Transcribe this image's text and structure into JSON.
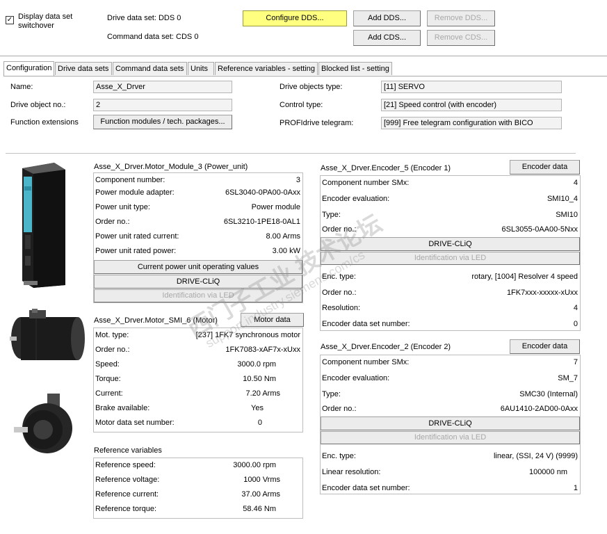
{
  "top": {
    "switchover_checked": true,
    "switchover_label_1": "Display data set",
    "switchover_label_2": "switchover",
    "dds_label": "Drive data set: DDS 0",
    "cds_label": "Command data set: CDS 0",
    "configure_dds": "Configure DDS...",
    "add_dds": "Add DDS...",
    "remove_dds": "Remove DDS...",
    "add_cds": "Add CDS...",
    "remove_cds": "Remove CDS..."
  },
  "tabs": [
    "Configuration",
    "Drive data sets",
    "Command data sets",
    "Units",
    "Reference variables - setting",
    "Blocked list - setting"
  ],
  "config": {
    "name_label": "Name:",
    "name_value": "Asse_X_Drver",
    "dono_label": "Drive object no.:",
    "dono_value": "2",
    "funcext_label": "Function extensions",
    "funcext_button": "Function modules / tech. packages...",
    "dotype_label": "Drive objects type:",
    "dotype_value": "[11] SERVO",
    "ctrl_label": "Control type:",
    "ctrl_value": "[21] Speed control (with encoder)",
    "telegram_label": "PROFIdrive telegram:",
    "telegram_value": "[999] Free telegram configuration with BICO"
  },
  "power_unit": {
    "title": "Asse_X_Drver.Motor_Module_3 (Power_unit)",
    "rows": [
      {
        "k": "Component number:",
        "v": "3"
      },
      {
        "k": "Power module adapter:",
        "v": "6SL3040-0PA00-0Axx"
      },
      {
        "k": "Power unit type:",
        "v": "Power module"
      },
      {
        "k": "Order no.:",
        "v": "6SL3210-1PE18-0AL1"
      },
      {
        "k": "Power unit rated current:",
        "v": "8.00 Arms"
      },
      {
        "k": "Power unit rated power:",
        "v": "3.00 kW"
      }
    ],
    "btn_operating": "Current power unit operating values",
    "btn_cliq": "DRIVE-CLiQ",
    "btn_led": "Identification via LED"
  },
  "motor": {
    "title": "Asse_X_Drver.Motor_SMI_6 (Motor)",
    "btn_data": "Motor data",
    "rows": [
      {
        "k": "Mot. type:",
        "v": "[237] 1FK7 synchronous motor"
      },
      {
        "k": "Order no.:",
        "v": "1FK7083-xAF7x-xUxx"
      },
      {
        "k": "Speed:",
        "v": "3000.0 rpm"
      },
      {
        "k": "Torque:",
        "v": "10.50 Nm"
      },
      {
        "k": "Current:",
        "v": "7.20 Arms"
      },
      {
        "k": "Brake available:",
        "v": "Yes"
      },
      {
        "k": "Motor data set number:",
        "v": "0"
      }
    ]
  },
  "reference": {
    "title": "Reference variables",
    "rows": [
      {
        "k": "Reference speed:",
        "v": "3000.00 rpm"
      },
      {
        "k": "Reference voltage:",
        "v": "1000 Vrms"
      },
      {
        "k": "Reference current:",
        "v": "37.00 Arms"
      },
      {
        "k": "Reference torque:",
        "v": "58.46 Nm"
      }
    ]
  },
  "encoder5": {
    "title": "Asse_X_Drver.Encoder_5 (Encoder 1)",
    "btn_data": "Encoder data",
    "rows_a": [
      {
        "k": "Component number SMx:",
        "v": "4"
      },
      {
        "k": "Encoder evaluation:",
        "v": "SMI10_4"
      },
      {
        "k": "Type:",
        "v": "SMI10"
      },
      {
        "k": "Order no.:",
        "v": "6SL3055-0AA00-5Nxx"
      }
    ],
    "btn_cliq": "DRIVE-CLiQ",
    "btn_led": "Identification via LED",
    "rows_b": [
      {
        "k": "Enc. type:",
        "v": "rotary, [1004] Resolver 4 speed"
      },
      {
        "k": "Order no.:",
        "v": "1FK7xxx-xxxxx-xUxx"
      },
      {
        "k": "Resolution:",
        "v": "4"
      },
      {
        "k": "Encoder data set number:",
        "v": "0"
      }
    ]
  },
  "encoder2": {
    "title": "Asse_X_Drver.Encoder_2 (Encoder 2)",
    "btn_data": "Encoder data",
    "rows_a": [
      {
        "k": "Component number SMx:",
        "v": "7"
      },
      {
        "k": "Encoder evaluation:",
        "v": "SM_7"
      },
      {
        "k": "Type:",
        "v": "SMC30 (Internal)"
      },
      {
        "k": "Order no.:",
        "v": "6AU1410-2AD00-0Axx"
      }
    ],
    "btn_cliq": "DRIVE-CLiQ",
    "btn_led": "Identification via LED",
    "rows_b": [
      {
        "k": "Enc. type:",
        "v": "linear,  (SSI,  24 V) (9999)"
      },
      {
        "k": "Linear resolution:",
        "v": "100000 nm"
      },
      {
        "k": "Encoder data set number:",
        "v": "1"
      }
    ]
  },
  "watermark": {
    "line1": "西门子工业 技术论坛",
    "line2": "support.industry.siemens.com/cs"
  }
}
